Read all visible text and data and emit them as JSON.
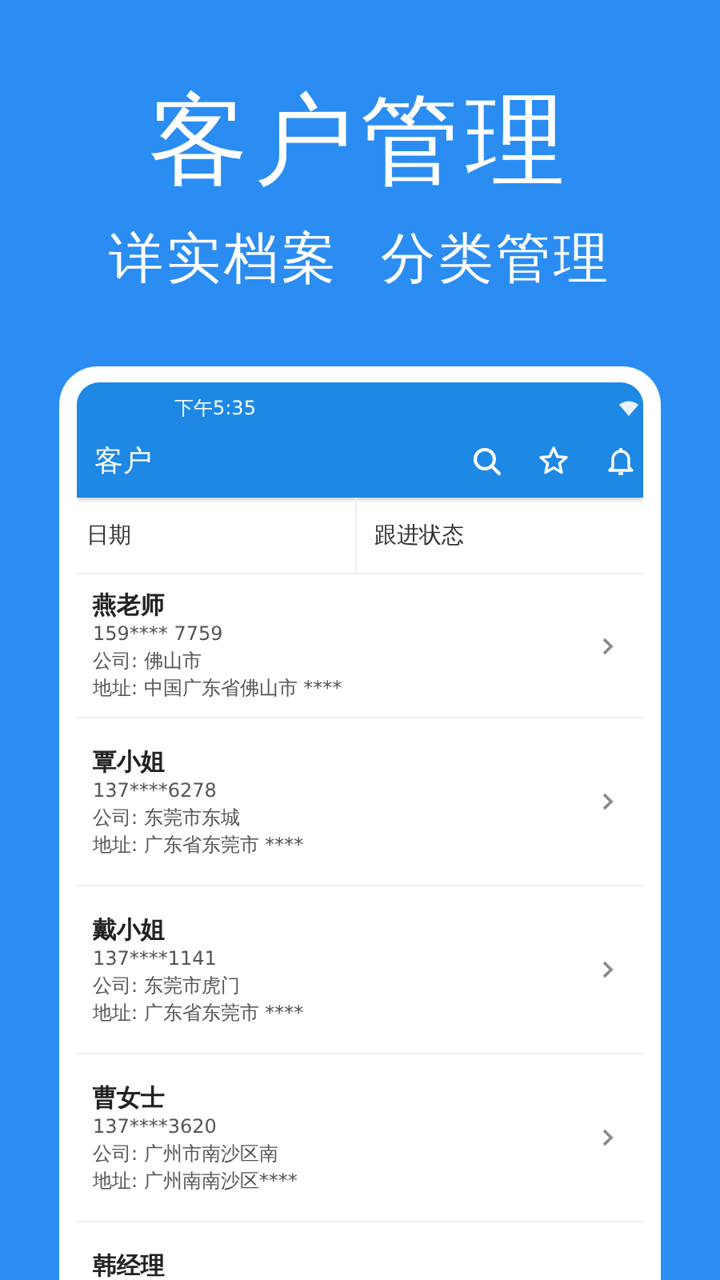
{
  "headline": "客户管理",
  "tagline": "详实档案  分类管理",
  "status_bar": {
    "time": "下午5:35"
  },
  "app_bar": {
    "title": "客户",
    "actions": [
      {
        "kind": "search"
      },
      {
        "kind": "star"
      },
      {
        "kind": "bell"
      }
    ]
  },
  "filters": [
    {
      "label": "日期"
    },
    {
      "label": "跟进状态"
    }
  ],
  "customers": [
    {
      "name": "燕老师",
      "phone": "159**** 7759",
      "company": "公司: 佛山市",
      "address": "地址: 中国广东省佛山市 ****"
    },
    {
      "name": "覃小姐",
      "phone": "137****6278",
      "company": "公司: 东莞市东城",
      "address": "地址: 广东省东莞市 ****"
    },
    {
      "name": "戴小姐",
      "phone": "137****1141",
      "company": "公司: 东莞市虎门",
      "address": "地址: 广东省东莞市 ****"
    },
    {
      "name": "曹女士",
      "phone": "137****3620",
      "company": "公司: 广州市南沙区南",
      "address": "地址: 广州南南沙区****"
    },
    {
      "name": "韩经理"
    }
  ]
}
